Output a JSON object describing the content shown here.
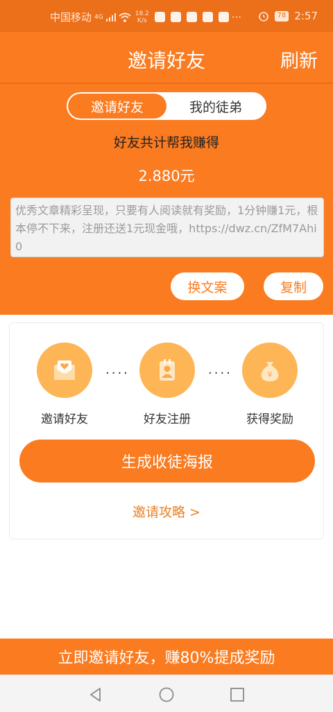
{
  "status_bar": {
    "carrier": "中国移动",
    "signal_tag": "4G",
    "speed_value": "18.2",
    "speed_unit": "K/s",
    "battery": "78",
    "time": "2:57"
  },
  "header": {
    "title": "邀请好友",
    "refresh": "刷新"
  },
  "tabs": [
    {
      "label": "邀请好友",
      "active": true
    },
    {
      "label": "我的徒弟",
      "active": false
    }
  ],
  "earnings": {
    "label": "好友共计帮我赚得",
    "amount": "2.880元"
  },
  "share_text": "优秀文章精彩呈现，只要有人阅读就有奖励，1分钟赚1元，根本停不下来，注册还送1元现金哦，https://dwz.cn/ZfM7Ahi0",
  "buttons": {
    "change_copy": "换文案",
    "copy": "复制",
    "poster": "生成收徒海报"
  },
  "steps": [
    {
      "label": "邀请好友",
      "icon": "envelope-heart-icon"
    },
    {
      "label": "好友注册",
      "icon": "register-card-icon"
    },
    {
      "label": "获得奖励",
      "icon": "money-bag-icon"
    }
  ],
  "dots": "····",
  "guide_link": "邀请攻略 >",
  "bottom_banner": "立即邀请好友，赚80%提成奖励",
  "colors": {
    "primary": "#fa7b20",
    "status_bar": "#ec6f1a",
    "step_icon": "#fdb556",
    "link": "#e98024"
  }
}
